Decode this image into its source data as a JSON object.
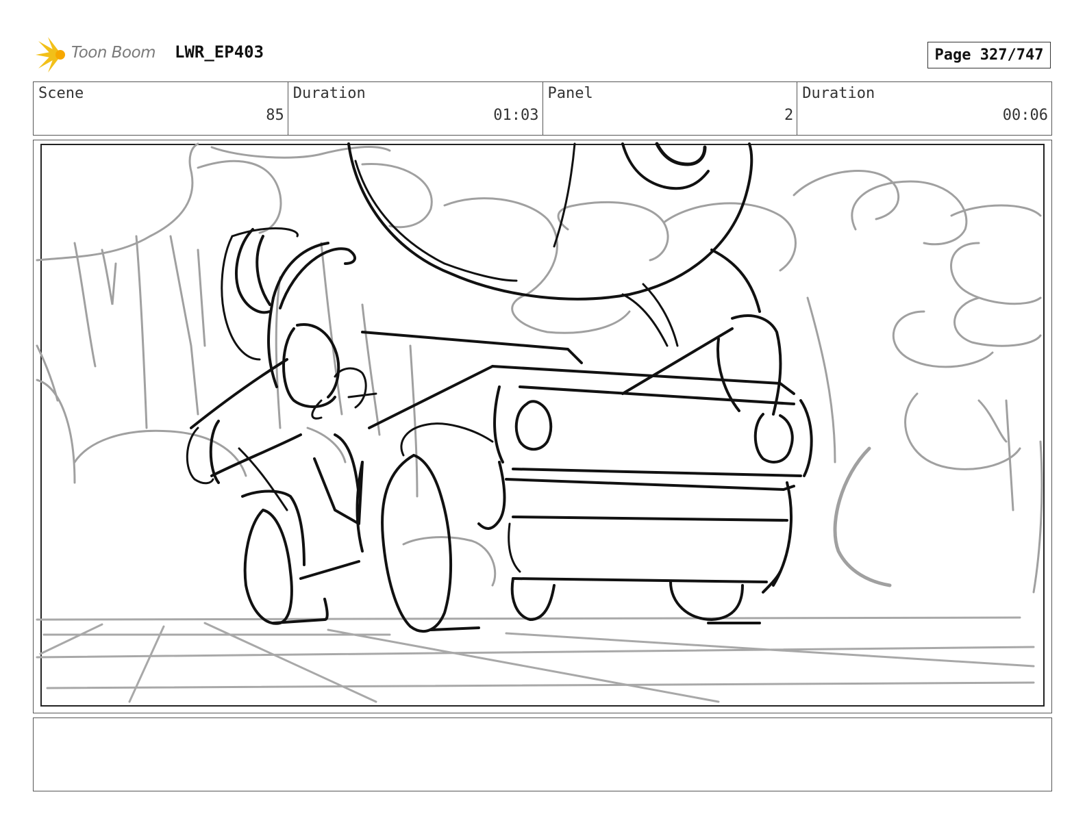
{
  "header": {
    "logo_text": "Toon Boom",
    "project": "LWR_EP403",
    "page": "Page 327/747"
  },
  "info": {
    "scene_label": "Scene",
    "scene_value": "85",
    "scene_duration_label": "Duration",
    "scene_duration_value": "01:03",
    "panel_label": "Panel",
    "panel_value": "2",
    "panel_duration_label": "Duration",
    "panel_duration_value": "00:06"
  },
  "panel": {
    "image": "storyboard sketch"
  },
  "caption": {
    "text": ""
  }
}
